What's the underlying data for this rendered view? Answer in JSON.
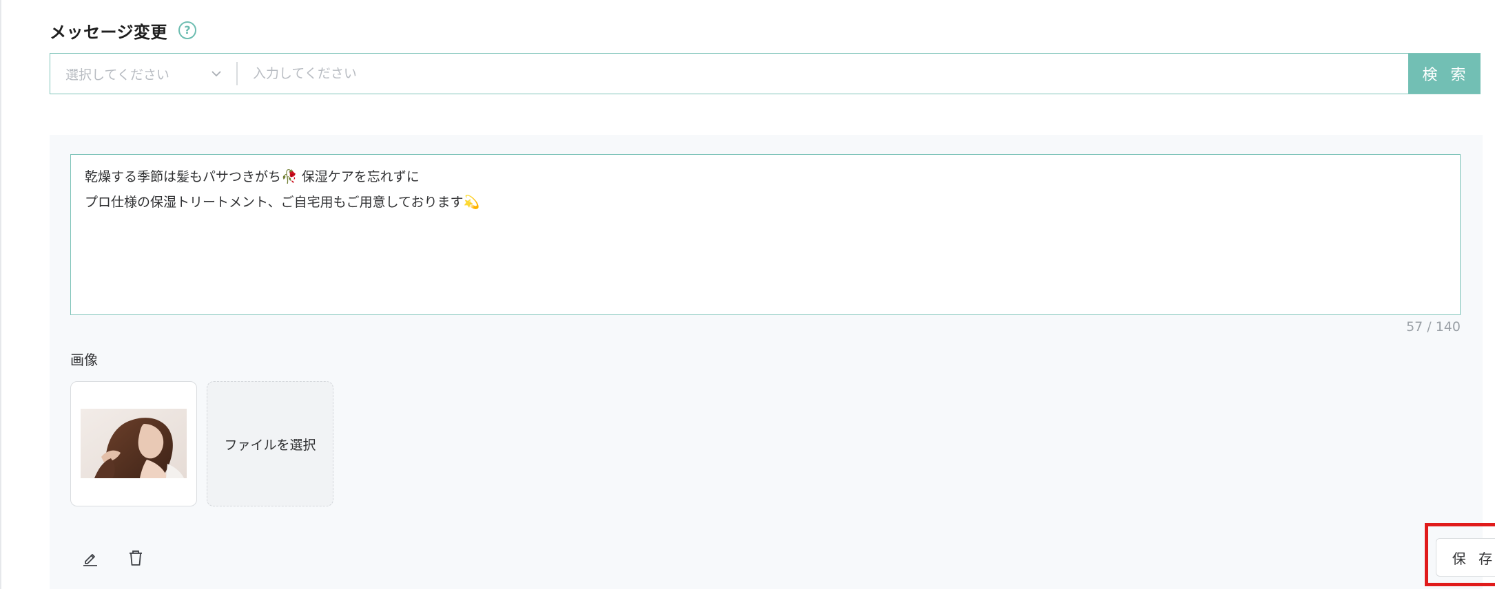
{
  "header": {
    "title": "メッセージ変更",
    "help_icon": "question-circle-icon"
  },
  "search": {
    "select_placeholder": "選択してください",
    "input_placeholder": "入力してください",
    "button_label": "検 索"
  },
  "message": {
    "lines": [
      "乾燥する季節は髪もパサつきがち🥀 保湿ケアを忘れずに",
      "プロ仕様の保湿トリートメント、ご自宅用もご用意しております💫"
    ],
    "counter": "57 / 140"
  },
  "images": {
    "label": "画像",
    "file_select_label": "ファイルを選択"
  },
  "actions": {
    "edit_icon": "pencil-icon",
    "delete_icon": "trash-icon",
    "save_label": "保 存"
  },
  "colors": {
    "accent": "#72bfb4",
    "border": "#7cc3b8",
    "highlight": "#e01b1b",
    "panel_bg": "#f7f9fb"
  }
}
